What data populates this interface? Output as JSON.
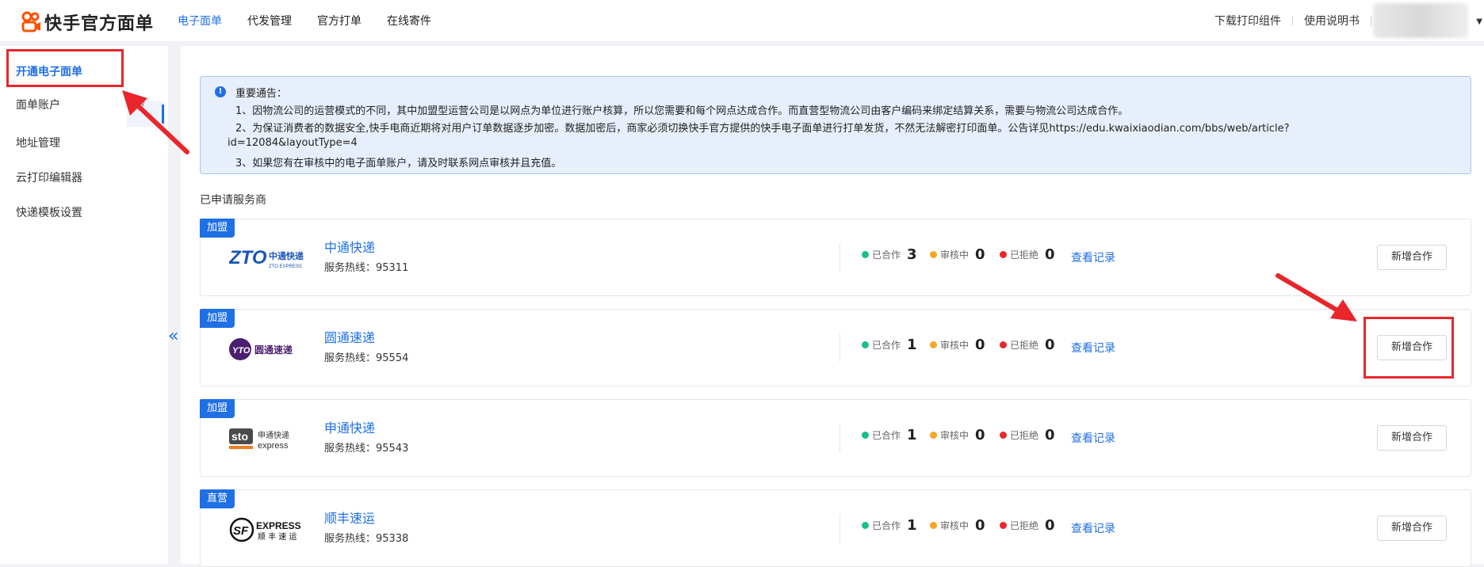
{
  "header": {
    "logo_text": "快手官方面单",
    "nav": [
      {
        "label": "电子面单",
        "active": true
      },
      {
        "label": "代发管理",
        "active": false
      },
      {
        "label": "官方打单",
        "active": false
      },
      {
        "label": "在线寄件",
        "active": false
      }
    ],
    "right_links": [
      "下载打印组件",
      "使用说明书"
    ]
  },
  "sidebar": {
    "items": [
      {
        "label": "开通电子面单",
        "active": true
      },
      {
        "label": "面单账户",
        "active": false
      },
      {
        "label": "地址管理",
        "active": false
      },
      {
        "label": "云打印编辑器",
        "active": false
      },
      {
        "label": "快递模板设置",
        "active": false
      }
    ],
    "collapse_glyph": "«"
  },
  "notice": {
    "title": "重要通告：",
    "lines": [
      "1、因物流公司的运营模式的不同，其中加盟型运营公司是以网点为单位进行账户核算，所以您需要和每个网点达成合作。而直营型物流公司由客户编码来绑定结算关系，需要与物流公司达成合作。",
      "2、为保证消费者的数据安全,快手电商近期将对用户订单数据逐步加密。数据加密后，商家必须切换快手官方提供的快手电子面单进行打单发货，不然无法解密打印面单。公告详见https://edu.kwaixiaodian.com/bbs/web/article?",
      "id=12084&layoutType=4",
      "3、如果您有在审核中的电子面单账户，请及时联系网点审核并且充值。"
    ]
  },
  "section_title": "已申请服务商",
  "stat_labels": {
    "cooperating": "已合作",
    "reviewing": "审核中",
    "rejected": "已拒绝"
  },
  "view_records_label": "查看记录",
  "add_cooperation_label": "新增合作",
  "providers": [
    {
      "tag": "加盟",
      "name": "中通快递",
      "hotline": "服务热线：95311",
      "logo": "zto-logo",
      "logo_text": "ZTO",
      "logo_sub": "中通快递",
      "cooperating": "3",
      "reviewing": "0",
      "rejected": "0"
    },
    {
      "tag": "加盟",
      "name": "圆通速递",
      "hotline": "服务热线：95554",
      "logo": "yto-logo",
      "logo_text": "YTO",
      "logo_sub": "圆通速递",
      "cooperating": "1",
      "reviewing": "0",
      "rejected": "0"
    },
    {
      "tag": "加盟",
      "name": "申通快递",
      "hotline": "服务热线：95543",
      "logo": "sto-logo",
      "logo_text": "sto",
      "logo_sub": "申通快递",
      "cooperating": "1",
      "reviewing": "0",
      "rejected": "0"
    },
    {
      "tag": "直营",
      "name": "顺丰速运",
      "hotline": "服务热线：95338",
      "logo": "sf-logo",
      "logo_text": "SF",
      "logo_sub": "EXPRESS",
      "cooperating": "1",
      "reviewing": "0",
      "rejected": "0"
    }
  ],
  "colors": {
    "accent": "#1f6fe5",
    "green": "#19be8c",
    "orange": "#f5a623",
    "red": "#e8262b"
  }
}
